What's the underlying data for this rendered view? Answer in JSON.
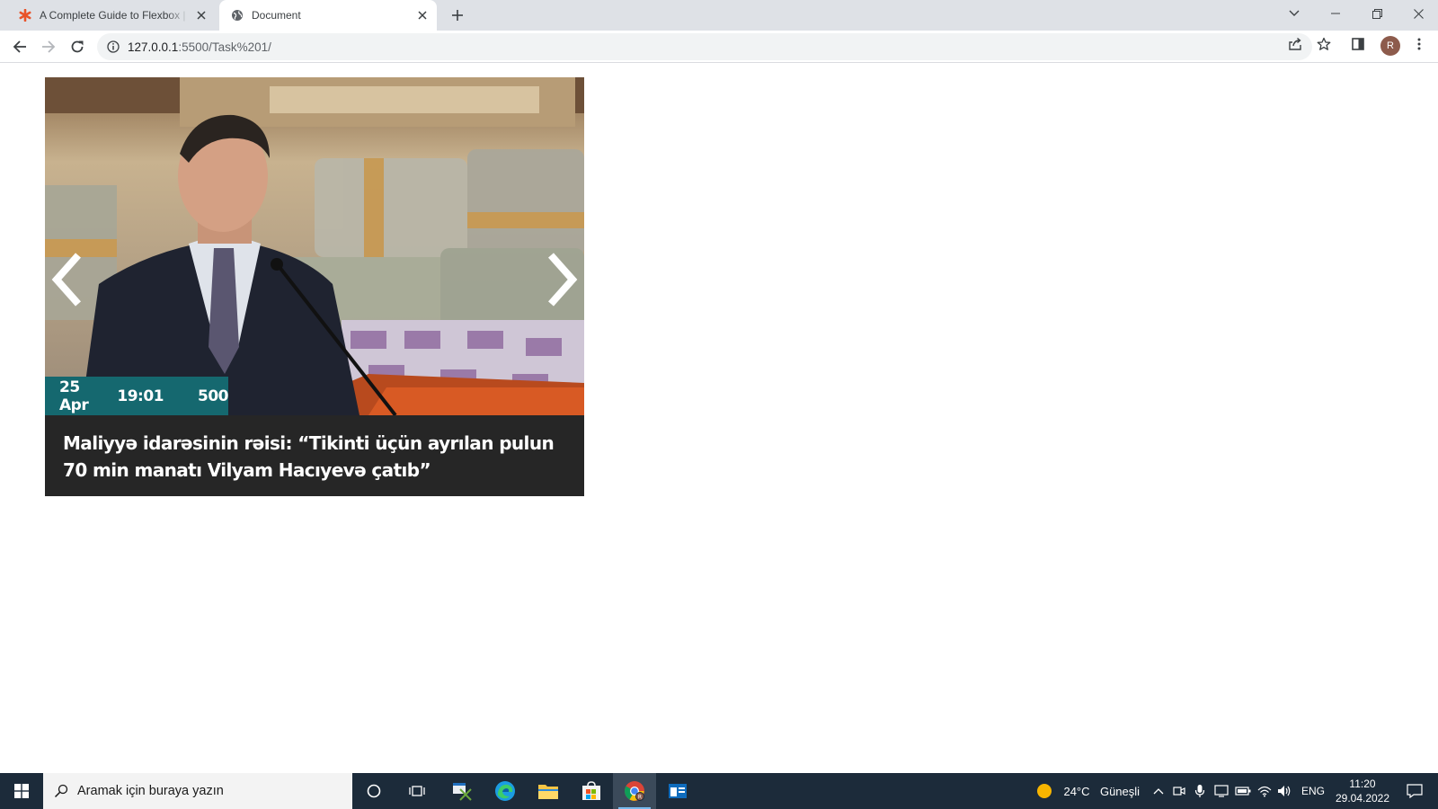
{
  "browser": {
    "tabs": [
      {
        "title": "A Complete Guide to Flexbox | CSS-Tricks",
        "favicon": "css-tricks-star-icon"
      },
      {
        "title": "Document",
        "favicon": "globe-icon",
        "active": true
      }
    ],
    "address_bar": {
      "host": "127.0.0.1",
      "path": ":5500/Task%201/",
      "icon": "info-icon"
    },
    "profile_initial": "R"
  },
  "slider": {
    "date": "25 Apr",
    "time": "19:01",
    "views": "500",
    "headline": "Maliyyə idarəsinin rəisi: “Tikinti üçün ayrılan pulun 70 min manatı Vilyam Hacıyevə çatıb”",
    "colors": {
      "meta_bar": "#15686f",
      "caption_bg": "#262626"
    }
  },
  "taskbar": {
    "search_placeholder": "Aramak için buraya yazın",
    "weather_temp": "24°C",
    "weather_text": "Güneşli",
    "language": "ENG",
    "time": "11:20",
    "date": "29.04.2022"
  }
}
